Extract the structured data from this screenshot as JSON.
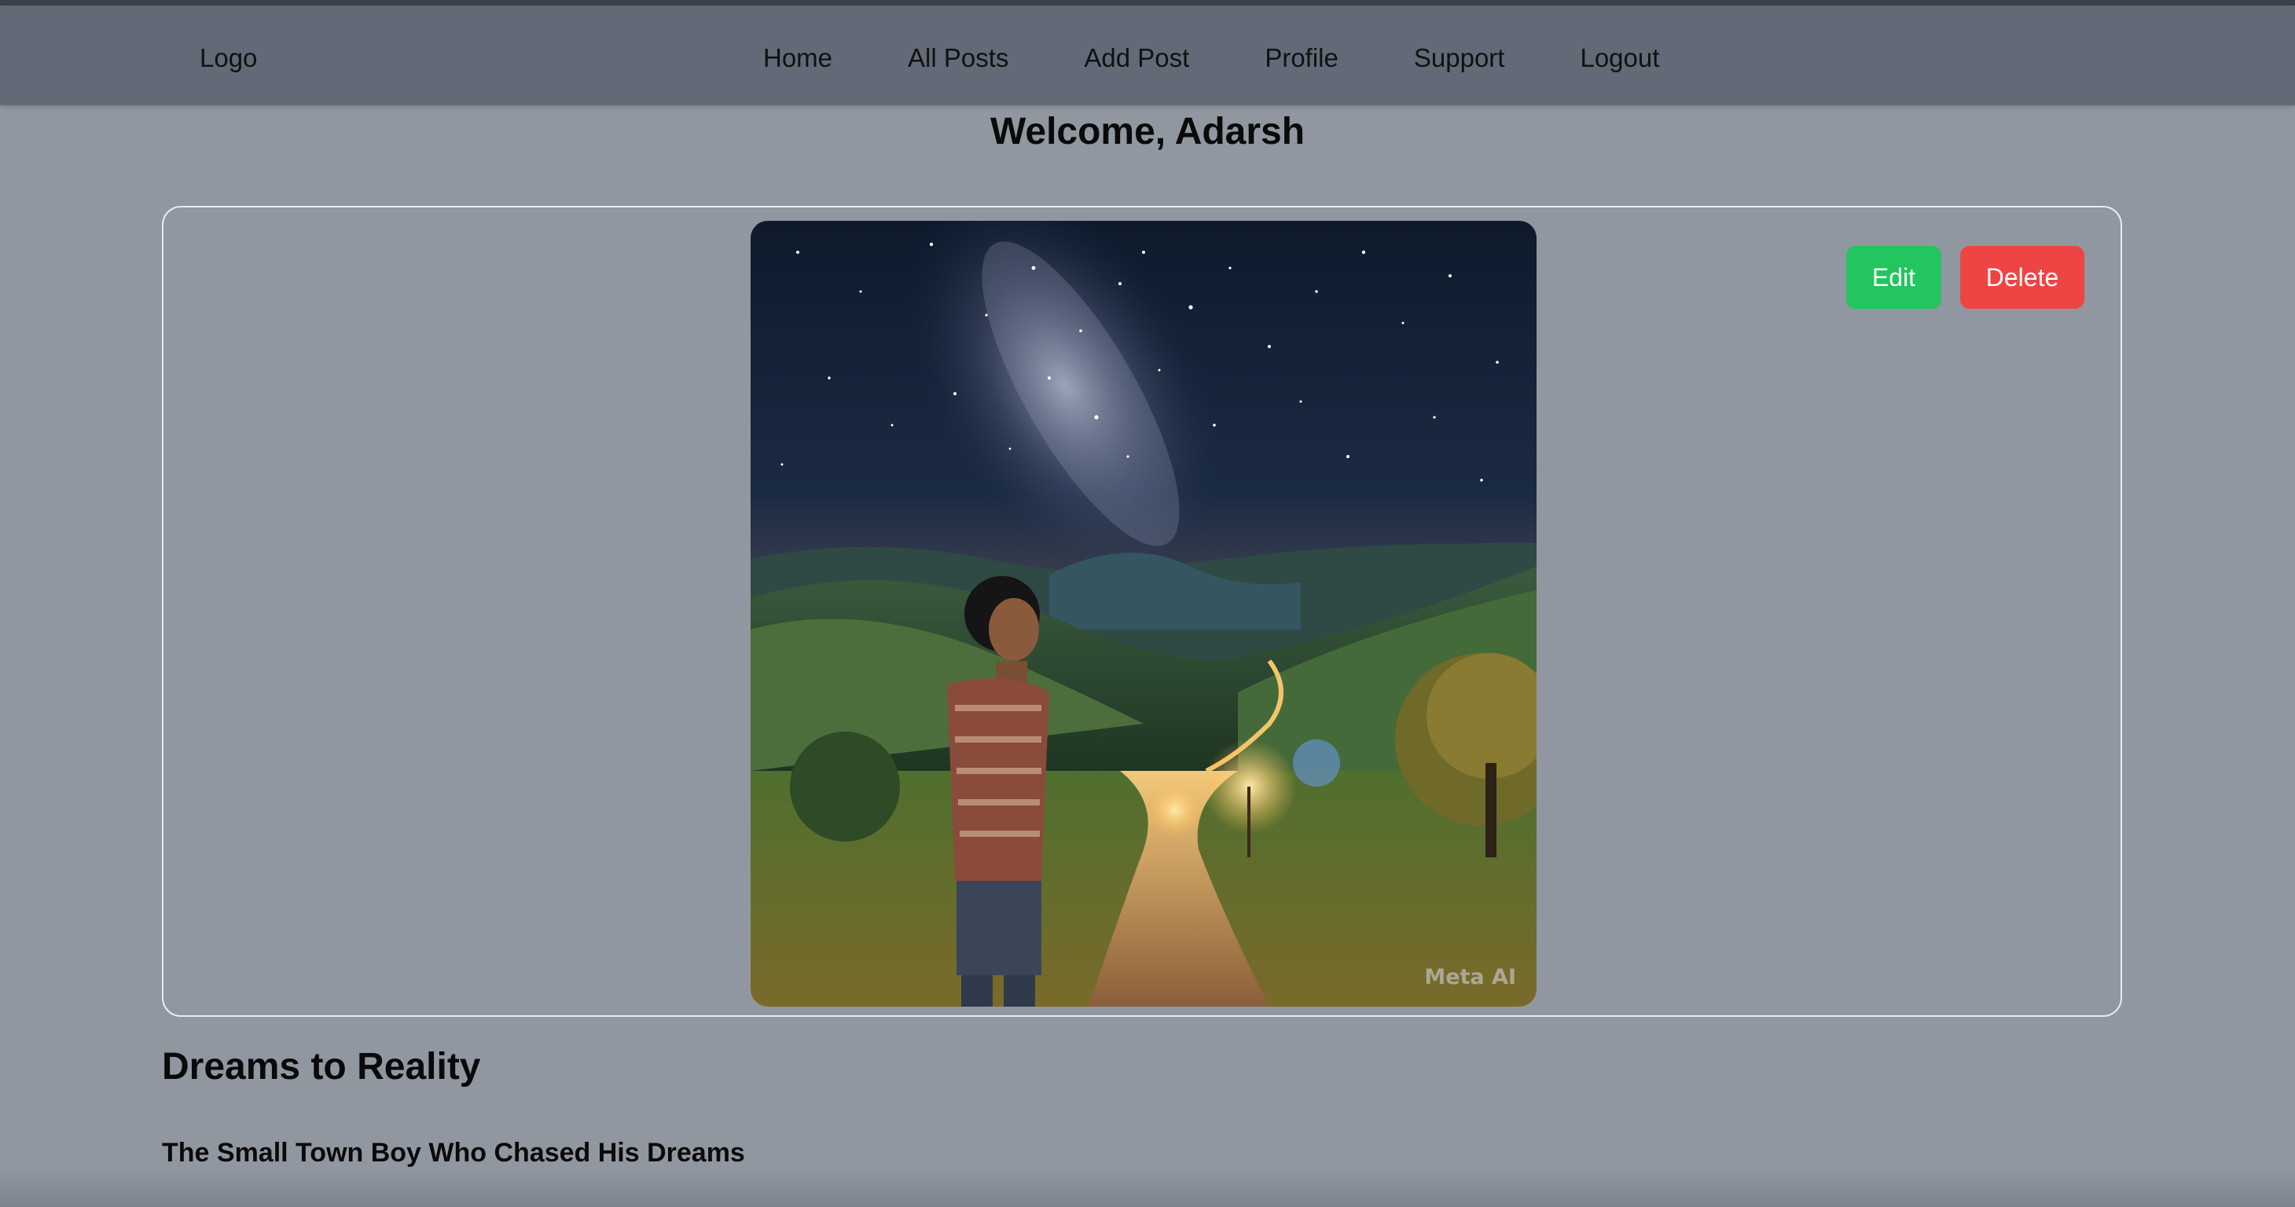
{
  "navbar": {
    "logo": "Logo",
    "links": [
      "Home",
      "All Posts",
      "Add Post",
      "Profile",
      "Support",
      "Logout"
    ]
  },
  "welcome": "Welcome, Adarsh",
  "post": {
    "image_watermark": "Meta AI",
    "edit_label": "Edit",
    "delete_label": "Delete",
    "title": "Dreams to Reality",
    "subtitle": "The Small Town Boy Who Chased His Dreams"
  },
  "colors": {
    "edit": "#22c55e",
    "delete": "#ef4444",
    "navbar": "#626a77",
    "background": "#9197a1"
  }
}
